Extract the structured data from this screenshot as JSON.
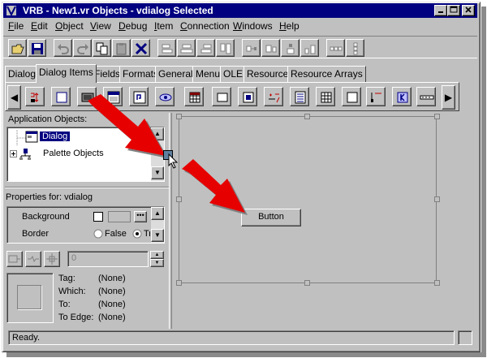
{
  "window": {
    "title": "VRB - New1.vr Objects - vdialog Selected",
    "controls": [
      "minimize",
      "maximize",
      "close"
    ]
  },
  "menubar": {
    "items": [
      {
        "label": "File",
        "mnemonic": "F"
      },
      {
        "label": "Edit",
        "mnemonic": "E"
      },
      {
        "label": "Object",
        "mnemonic": "O"
      },
      {
        "label": "View",
        "mnemonic": "V"
      },
      {
        "label": "Debug",
        "mnemonic": "D"
      },
      {
        "label": "Item",
        "mnemonic": "I"
      },
      {
        "label": "Connection",
        "mnemonic": "C"
      },
      {
        "label": "Windows",
        "mnemonic": "W"
      },
      {
        "label": "Help",
        "mnemonic": "H"
      }
    ]
  },
  "toolbar": {
    "buttons": [
      "open-icon",
      "save-icon",
      "undo-icon",
      "redo-icon",
      "copy-icon",
      "paste-icon",
      "delete-icon",
      "align-left-icon",
      "align-center-icon",
      "align-right-icon",
      "align-top-icon",
      "align-middle-icon",
      "align-bottom-icon",
      "same-size-icon",
      "space-horizontal-icon",
      "space-vertical-icon"
    ]
  },
  "tabs": {
    "items": [
      "Dialog",
      "Dialog Items",
      "Fields",
      "Formats",
      "General",
      "Menu",
      "OLE",
      "Resource",
      "Resource Arrays"
    ],
    "active": "Dialog Items"
  },
  "palette": {
    "items": [
      "spin-icon",
      "checkbox-icon",
      "frame-icon",
      "group-icon",
      "icon-button-icon",
      "radio-icon",
      "grid-icon",
      "button-icon",
      "bitmap-icon",
      "numeric-icon",
      "list-icon",
      "table-icon",
      "blank-icon",
      "range-icon",
      "key-icon",
      "slider-icon"
    ]
  },
  "app_objects": {
    "label": "Application Objects:",
    "items": [
      {
        "label": "Dialog",
        "selected": true
      },
      {
        "label": "Palette Objects",
        "selected": false
      }
    ]
  },
  "properties": {
    "header": "Properties for: vdialog",
    "rows": [
      {
        "name": "Background"
      },
      {
        "name": "Border",
        "false_label": "False",
        "true_label": "Tr"
      }
    ],
    "value_field": "0"
  },
  "connection": {
    "fields": [
      {
        "label": "Tag:",
        "value": "(None)"
      },
      {
        "label": "Which:",
        "value": "(None)"
      },
      {
        "label": "To:",
        "value": "(None)"
      },
      {
        "label": "To Edge:",
        "value": "(None)"
      }
    ]
  },
  "design": {
    "button_label": "Button"
  },
  "status": {
    "text": "Ready."
  },
  "colors": {
    "face": "#c0c0c0",
    "titlebar": "#000080",
    "arrow": "#e60000"
  }
}
